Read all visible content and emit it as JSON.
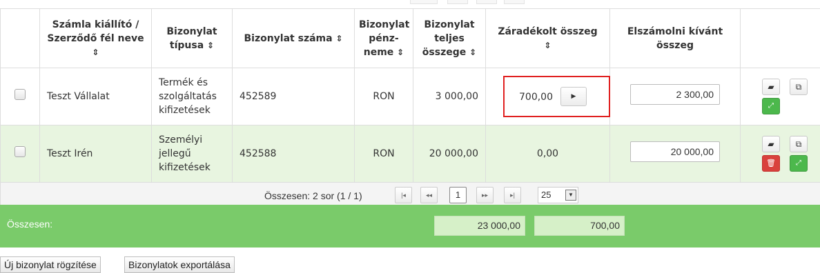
{
  "table": {
    "headers": [
      {
        "label": "",
        "sort": ""
      },
      {
        "label": "Számla kiállító / Szerződő fél neve",
        "sort": "⇕"
      },
      {
        "label": "Bizonylat típusa",
        "sort": "⇕"
      },
      {
        "label": "Bizonylat száma",
        "sort": "⇕"
      },
      {
        "label": "Bizonylat pénz-neme",
        "sort": "⇕"
      },
      {
        "label": "Bizonylat teljes összege",
        "sort": "⇕"
      },
      {
        "label": "Záradékolt összeg",
        "sort": "⇕"
      },
      {
        "label": "Elszámolni kívánt összeg",
        "sort": ""
      },
      {
        "label": "",
        "sort": ""
      }
    ],
    "rows": [
      {
        "name": "Teszt Vállalat",
        "type": "Termék és szolgáltatás kifizetések",
        "number": "452589",
        "currency": "RON",
        "total": "3 000,00",
        "clause": "700,00",
        "settle": "2 300,00"
      },
      {
        "name": "Teszt Irén",
        "type": "Személyi jellegű kifizetések",
        "number": "452588",
        "currency": "RON",
        "total": "20 000,00",
        "clause": "0,00",
        "settle": "20 000,00"
      }
    ]
  },
  "pager": {
    "summary": "Összesen: 2 sor (1 / 1)",
    "first": "|◂",
    "prev": "◂◂",
    "page": "1",
    "next": "▸▸",
    "last": "▸|",
    "page_size": "25"
  },
  "totals": {
    "label": "Összesen:",
    "total": "23 000,00",
    "clause": "700,00"
  },
  "buttons": {
    "new": "Új bizonylat rögzítése",
    "export": "Bizonylatok exportálása"
  },
  "icons": {
    "open": "folder-open-icon",
    "copy": "copy-icon",
    "expand": "expand-icon",
    "delete": "trash-icon",
    "arrow": "caret-right-icon"
  },
  "colors": {
    "total_bar": "#7acb6a",
    "row_highlight": "#e8f5e0",
    "highlight_border": "#e02020",
    "green_button": "#4cb84c",
    "red_button": "#d9413d"
  }
}
